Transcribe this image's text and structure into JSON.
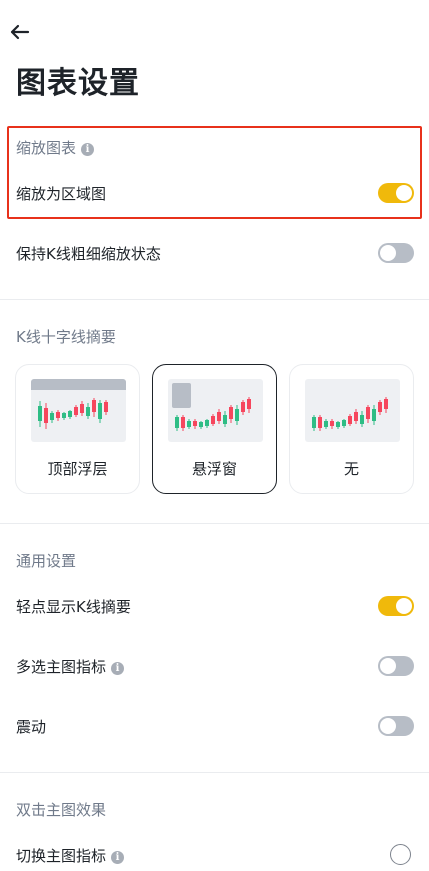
{
  "page": {
    "title": "图表设置"
  },
  "zoom_section": {
    "title": "缩放图表",
    "zoom_to_area": {
      "label": "缩放为区域图",
      "on": true
    }
  },
  "keep_thickness": {
    "label": "保持K线粗细缩放状态",
    "on": false
  },
  "crosshair": {
    "title": "K线十字线摘要",
    "options": [
      {
        "label": "顶部浮层",
        "selected": false
      },
      {
        "label": "悬浮窗",
        "selected": true
      },
      {
        "label": "无",
        "selected": false
      }
    ]
  },
  "general": {
    "title": "通用设置",
    "tap_show_summary": {
      "label": "轻点显示K线摘要",
      "on": true
    },
    "multi_select_indicators": {
      "label": "多选主图指标",
      "on": false
    },
    "vibration": {
      "label": "震动",
      "on": false
    }
  },
  "double_tap": {
    "title": "双击主图效果",
    "switch_indicator": {
      "label": "切换主图指标",
      "selected": false
    }
  },
  "colors": {
    "accent": "#f0b90b",
    "toggle_off": "#b7bdc6",
    "up": "#2ebd85",
    "down": "#f6465d",
    "highlight": "#e8311b"
  },
  "icons": {
    "back": "arrow-left-icon",
    "info": "info-icon"
  }
}
